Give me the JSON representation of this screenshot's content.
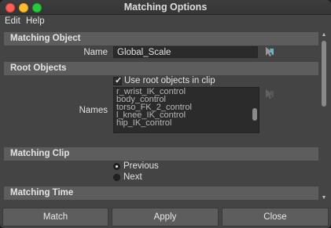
{
  "window": {
    "title": "Matching Options"
  },
  "menubar": {
    "items": [
      "Edit",
      "Help"
    ]
  },
  "sections": {
    "matching_object": {
      "title": "Matching Object",
      "name_label": "Name",
      "name_value": "Global_Scale"
    },
    "root_objects": {
      "title": "Root Objects",
      "checkbox_label": "Use root objects in clip",
      "checkbox_checked": true,
      "names_label": "Names",
      "names": [
        "r_wrist_IK_control",
        "body_control",
        "torso_FK_2_control",
        "l_knee_IK_control",
        "hip_IK_control"
      ]
    },
    "matching_clip": {
      "title": "Matching Clip",
      "options": [
        "Previous",
        "Next"
      ],
      "selected": "Previous"
    },
    "matching_time": {
      "title": "Matching Time"
    }
  },
  "buttons": {
    "match": "Match",
    "apply": "Apply",
    "close": "Close"
  },
  "colors": {
    "picker_accent": "#5fb6c8",
    "panel": "#444444",
    "header": "#5d5d5d"
  }
}
